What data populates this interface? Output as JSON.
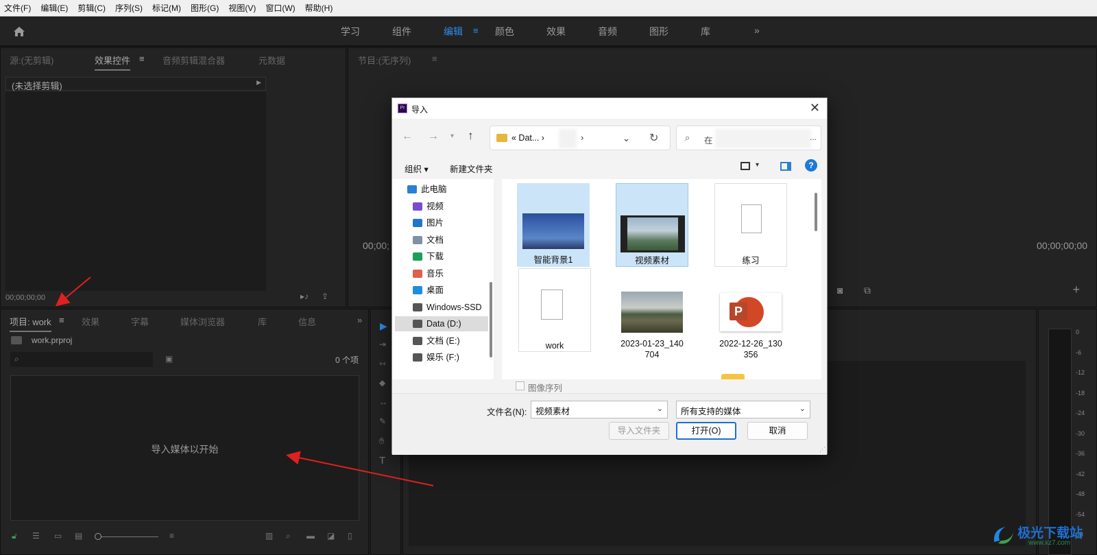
{
  "menu": [
    "文件(F)",
    "编辑(E)",
    "剪辑(C)",
    "序列(S)",
    "标记(M)",
    "图形(G)",
    "视图(V)",
    "窗口(W)",
    "帮助(H)"
  ],
  "workspaces": [
    "学习",
    "组件",
    "编辑",
    "颜色",
    "效果",
    "音频",
    "图形",
    "库"
  ],
  "active_workspace": "编辑",
  "source_panel": {
    "tabs": [
      "源:(无剪辑)",
      "效果控件",
      "音频剪辑混合器",
      "元数据"
    ],
    "active_tab": "效果控件",
    "no_clip": "(未选择剪辑)",
    "timecode": "00;00;00;00"
  },
  "program_panel": {
    "tab": "节目:(无序列)",
    "timecode_left": "00;00;",
    "timecode_right": "00;00;00;00"
  },
  "project_panel": {
    "tabs": [
      "项目: work",
      "效果",
      "字幕",
      "媒体浏览器",
      "库",
      "信息"
    ],
    "active_tab": "项目: work",
    "file": "work.prproj",
    "count": "0 个项",
    "empty_text": "导入媒体以开始"
  },
  "meter_labels": [
    "0",
    "-6",
    "-12",
    "-18",
    "-24",
    "-30",
    "-36",
    "-42",
    "-48",
    "-54",
    "dB"
  ],
  "dialog": {
    "title": "导入",
    "breadcrumb": "« Dat... ›",
    "search_placeholder": "在",
    "toolbar": {
      "organize": "组织 ▾",
      "new_folder": "新建文件夹"
    },
    "nav": [
      {
        "label": "此电脑",
        "icon": "computer-icon",
        "color": "#2b7fd4"
      },
      {
        "label": "视频",
        "icon": "video-folder-icon",
        "color": "#7a4bd0"
      },
      {
        "label": "图片",
        "icon": "picture-folder-icon",
        "color": "#2176c8"
      },
      {
        "label": "文档",
        "icon": "document-folder-icon",
        "color": "#8090a8"
      },
      {
        "label": "下载",
        "icon": "download-icon",
        "color": "#1e9e5c"
      },
      {
        "label": "音乐",
        "icon": "music-icon",
        "color": "#e0604a"
      },
      {
        "label": "桌面",
        "icon": "desktop-icon",
        "color": "#1c8ee0"
      },
      {
        "label": "Windows-SSD",
        "icon": "drive-icon",
        "color": "#555"
      },
      {
        "label": "Data (D:)",
        "icon": "drive-icon",
        "color": "#555"
      },
      {
        "label": "文档 (E:)",
        "icon": "drive-icon",
        "color": "#555"
      },
      {
        "label": "娱乐 (F:)",
        "icon": "drive-icon",
        "color": "#555"
      }
    ],
    "selected_nav": "Data (D:)",
    "files": [
      {
        "name": "智能背景1",
        "type": "image-blue"
      },
      {
        "name": "视频素材",
        "type": "video"
      },
      {
        "name": "练习",
        "type": "blank"
      },
      {
        "name": "work",
        "type": "blank"
      },
      {
        "name": "2023-01-23_140704",
        "type": "photo"
      },
      {
        "name": "2022-12-26_130356",
        "type": "ppt"
      }
    ],
    "image_sequence": "图像序列",
    "filename_label": "文件名(N):",
    "filename_value": "视频素材",
    "filetype_value": "所有支持的媒体",
    "buttons": {
      "import_folder": "导入文件夹",
      "open": "打开(O)",
      "cancel": "取消"
    }
  },
  "watermark": {
    "text": "极光下载站",
    "url": "www.xz7.com"
  }
}
